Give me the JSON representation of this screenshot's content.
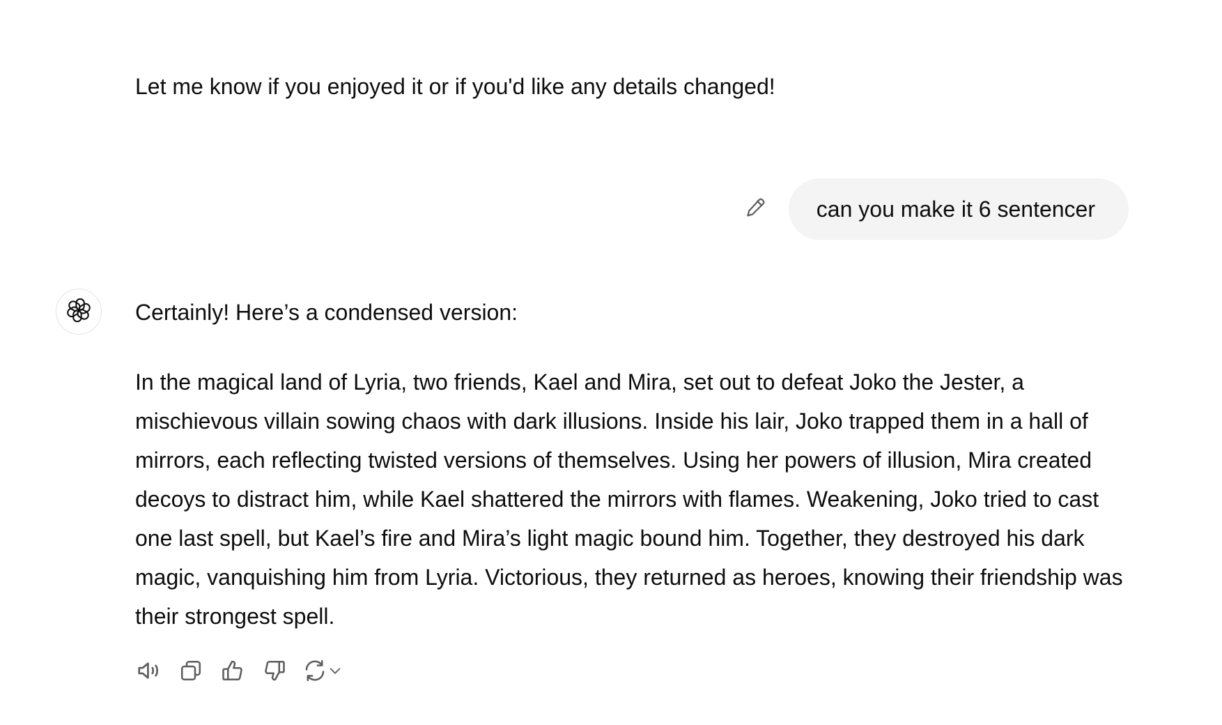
{
  "previous_message": {
    "closing_text": "Let me know if you enjoyed it or if you'd like any details changed!"
  },
  "user_message": {
    "text": "can you make it 6 sentencer",
    "edit_icon": "pencil-icon"
  },
  "assistant_message": {
    "avatar_icon": "openai-logo-icon",
    "intro": "Certainly! Here’s a condensed version:",
    "body": "In the magical land of Lyria, two friends, Kael and Mira, set out to defeat Joko the Jester, a mischievous villain sowing chaos with dark illusions. Inside his lair, Joko trapped them in a hall of mirrors, each reflecting twisted versions of themselves. Using her powers of illusion, Mira created decoys to distract him, while Kael shattered the mirrors with flames. Weakening, Joko tried to cast one last spell, but Kael’s fire and Mira’s light magic bound him. Together, they destroyed his dark magic, vanquishing him from Lyria. Victorious, they returned as heroes, knowing their friendship was their strongest spell."
  },
  "action_bar": {
    "icons": [
      "read-aloud-icon",
      "copy-icon",
      "thumbs-up-icon",
      "thumbs-down-icon",
      "regenerate-icon",
      "chevron-down-icon"
    ]
  },
  "colors": {
    "text": "#0d0d0d",
    "bubble_background": "#f4f4f4",
    "icon": "#5d5d5d",
    "avatar_border": "#e3e3e3"
  }
}
